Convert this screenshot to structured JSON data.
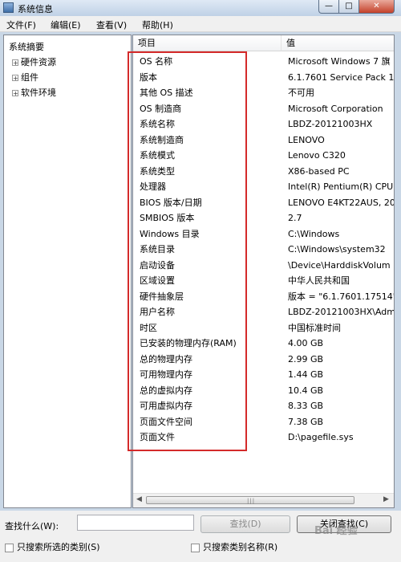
{
  "window": {
    "title": "系统信息"
  },
  "menu": [
    {
      "label": "文件(F)"
    },
    {
      "label": "编辑(E)"
    },
    {
      "label": "查看(V)"
    },
    {
      "label": "帮助(H)"
    }
  ],
  "tree": {
    "root": "系统摘要",
    "children": [
      {
        "label": "硬件资源"
      },
      {
        "label": "组件"
      },
      {
        "label": "软件环境"
      }
    ]
  },
  "table": {
    "headers": {
      "item": "项目",
      "value": "值"
    },
    "rows": [
      {
        "item": "OS 名称",
        "value": "Microsoft Windows 7 旗"
      },
      {
        "item": "版本",
        "value": "6.1.7601 Service Pack 1"
      },
      {
        "item": "其他 OS 描述",
        "value": "不可用"
      },
      {
        "item": "OS 制造商",
        "value": "Microsoft Corporation"
      },
      {
        "item": "系统名称",
        "value": "LBDZ-20121003HX"
      },
      {
        "item": "系统制造商",
        "value": "LENOVO"
      },
      {
        "item": "系统模式",
        "value": "Lenovo C320"
      },
      {
        "item": "系统类型",
        "value": "X86-based PC"
      },
      {
        "item": "处理器",
        "value": "Intel(R) Pentium(R) CPU"
      },
      {
        "item": "BIOS 版本/日期",
        "value": "LENOVO E4KT22AUS, 20"
      },
      {
        "item": "SMBIOS 版本",
        "value": "2.7"
      },
      {
        "item": "Windows 目录",
        "value": "C:\\Windows"
      },
      {
        "item": "系统目录",
        "value": "C:\\Windows\\system32"
      },
      {
        "item": "启动设备",
        "value": "\\Device\\HarddiskVolum"
      },
      {
        "item": "区域设置",
        "value": "中华人民共和国"
      },
      {
        "item": "硬件抽象层",
        "value": "版本 = \"6.1.7601.17514\""
      },
      {
        "item": "用户名称",
        "value": "LBDZ-20121003HX\\Adm"
      },
      {
        "item": "时区",
        "value": "中国标准时间"
      },
      {
        "item": "已安装的物理内存(RAM)",
        "value": "4.00 GB"
      },
      {
        "item": "总的物理内存",
        "value": "2.99 GB"
      },
      {
        "item": "可用物理内存",
        "value": "1.44 GB"
      },
      {
        "item": "总的虚拟内存",
        "value": "10.4 GB"
      },
      {
        "item": "可用虚拟内存",
        "value": "8.33 GB"
      },
      {
        "item": "页面文件空间",
        "value": "7.38 GB"
      },
      {
        "item": "页面文件",
        "value": "D:\\pagefile.sys"
      }
    ]
  },
  "search": {
    "label": "查找什么(W):",
    "value": "",
    "find_button": "查找(D)",
    "close_find_button": "关闭查找(C)",
    "checkbox_selected_category": "只搜索所选的类别(S)",
    "checkbox_category_names": "只搜索类别名称(R)"
  },
  "watermark": "Bai 经验",
  "colors": {
    "highlight_box": "#d42a2a"
  }
}
